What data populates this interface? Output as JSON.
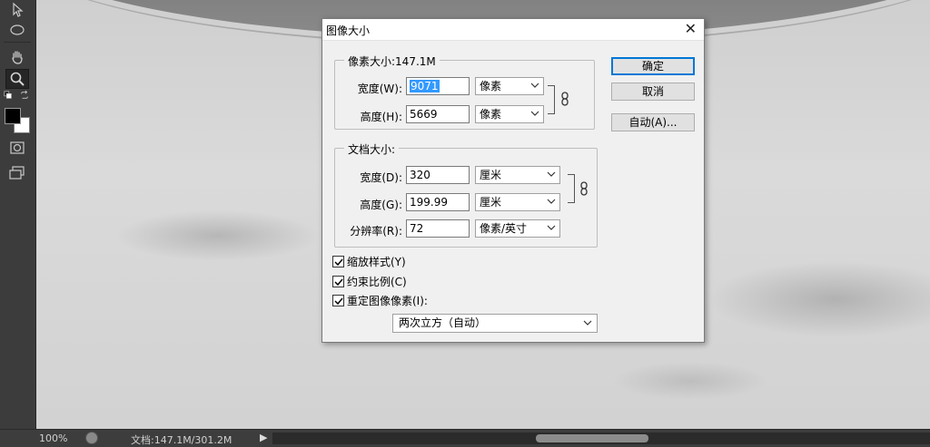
{
  "toolbar": {
    "tools": [
      "arrow-tool",
      "ellipse-marquee-tool",
      "hand-tool",
      "zoom-tool"
    ],
    "foreground_color": "#000000",
    "background_color": "#ffffff"
  },
  "status": {
    "zoom": "100%",
    "doc_info": "文档:147.1M/301.2M",
    "arrow": "▶"
  },
  "dialog": {
    "title": "图像大小",
    "close": "✕",
    "pixel_dims": {
      "legend": "像素大小:147.1M",
      "width_label": "宽度(W):",
      "width_value": "9071",
      "width_unit": "像素",
      "height_label": "高度(H):",
      "height_value": "5669",
      "height_unit": "像素"
    },
    "doc_size": {
      "legend": "文档大小:",
      "width_label": "宽度(D):",
      "width_value": "320",
      "width_unit": "厘米",
      "height_label": "高度(G):",
      "height_value": "199.99",
      "height_unit": "厘米",
      "res_label": "分辨率(R):",
      "res_value": "72",
      "res_unit": "像素/英寸"
    },
    "buttons": {
      "ok": "确定",
      "cancel": "取消",
      "auto": "自动(A)..."
    },
    "checkboxes": {
      "scale_styles": "缩放样式(Y)",
      "constrain": "约束比例(C)",
      "resample": "重定图像像素(I):"
    },
    "resample_method": "两次立方（自动）",
    "accent_color": "#0078d7",
    "selection_color": "#3399ff"
  }
}
